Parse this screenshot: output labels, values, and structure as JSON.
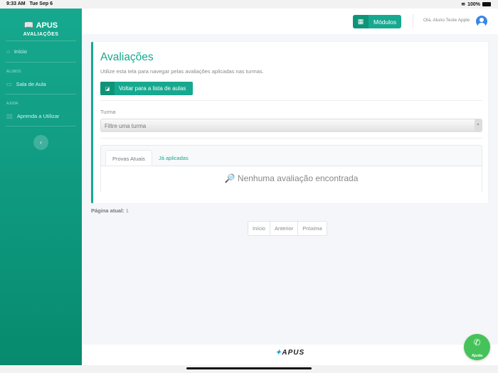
{
  "statusbar": {
    "time": "9:33 AM",
    "date": "Tue Sep 6",
    "battery": "100%"
  },
  "sidebar": {
    "brand": "APUS",
    "subtitle": "AVALIAÇÕES",
    "items": [
      {
        "label": "Início",
        "icon": "home-icon"
      }
    ],
    "sections": [
      {
        "title": "ALUNOS",
        "items": [
          {
            "label": "Sala de Aula"
          }
        ]
      },
      {
        "title": "AJUDA",
        "items": [
          {
            "label": "Aprenda a Utilizar"
          }
        ]
      }
    ],
    "collapse": "‹"
  },
  "header": {
    "modules_label": "Módulos",
    "greeting": "Olá, Aluno Teste Apple"
  },
  "main": {
    "title": "Avaliações",
    "subtitle": "Utilize esta tela para navegar pelas avaliações aplicadas nas turmas.",
    "back_label": "Voltar para a lista de aulas",
    "filter_label": "Turma",
    "filter_placeholder": "Filtre uma turma",
    "tabs": [
      {
        "label": "Provas Atuais",
        "active": true
      },
      {
        "label": "Já aplicadas",
        "active": false
      }
    ],
    "empty_message": "Nenhuma avaliação encontrada",
    "current_page_label": "Página atual:",
    "current_page": "1",
    "pager": [
      "Início",
      "Anterior",
      "Próxima"
    ]
  },
  "footer": {
    "logo": "APUS"
  },
  "help": {
    "label": "Ajuda"
  },
  "colors": {
    "accent": "#16a98f",
    "whatsapp": "#45c35a"
  }
}
